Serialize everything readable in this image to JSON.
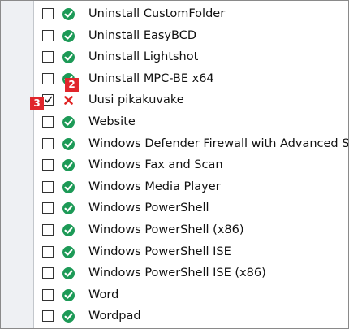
{
  "items": [
    {
      "label": "Uninstall CustomFolder",
      "checked": false,
      "status": "ok",
      "status_icon": "green-check-circle-icon"
    },
    {
      "label": "Uninstall EasyBCD",
      "checked": false,
      "status": "ok",
      "status_icon": "green-check-circle-icon"
    },
    {
      "label": "Uninstall Lightshot",
      "checked": false,
      "status": "ok",
      "status_icon": "green-check-circle-icon"
    },
    {
      "label": "Uninstall MPC-BE x64",
      "checked": false,
      "status": "ok",
      "status_icon": "green-check-circle-icon"
    },
    {
      "label": "Uusi pikakuvake",
      "checked": true,
      "status": "error",
      "status_icon": "red-x-icon"
    },
    {
      "label": "Website",
      "checked": false,
      "status": "ok",
      "status_icon": "green-check-circle-icon"
    },
    {
      "label": "Windows Defender Firewall with Advanced S",
      "checked": false,
      "status": "ok",
      "status_icon": "green-check-circle-icon"
    },
    {
      "label": "Windows Fax and Scan",
      "checked": false,
      "status": "ok",
      "status_icon": "green-check-circle-icon"
    },
    {
      "label": "Windows Media Player",
      "checked": false,
      "status": "ok",
      "status_icon": "green-check-circle-icon"
    },
    {
      "label": "Windows PowerShell",
      "checked": false,
      "status": "ok",
      "status_icon": "green-check-circle-icon"
    },
    {
      "label": "Windows PowerShell (x86)",
      "checked": false,
      "status": "ok",
      "status_icon": "green-check-circle-icon"
    },
    {
      "label": "Windows PowerShell ISE",
      "checked": false,
      "status": "ok",
      "status_icon": "green-check-circle-icon"
    },
    {
      "label": "Windows PowerShell ISE (x86)",
      "checked": false,
      "status": "ok",
      "status_icon": "green-check-circle-icon"
    },
    {
      "label": "Word",
      "checked": false,
      "status": "ok",
      "status_icon": "green-check-circle-icon"
    },
    {
      "label": "Wordpad",
      "checked": false,
      "status": "ok",
      "status_icon": "green-check-circle-icon"
    }
  ],
  "annotations": [
    {
      "number": "2",
      "color": "#e0262c"
    },
    {
      "number": "3",
      "color": "#e0262c"
    }
  ],
  "colors": {
    "ok": "#1d9a57",
    "error": "#e02424",
    "gutter": "#eef0f3"
  }
}
